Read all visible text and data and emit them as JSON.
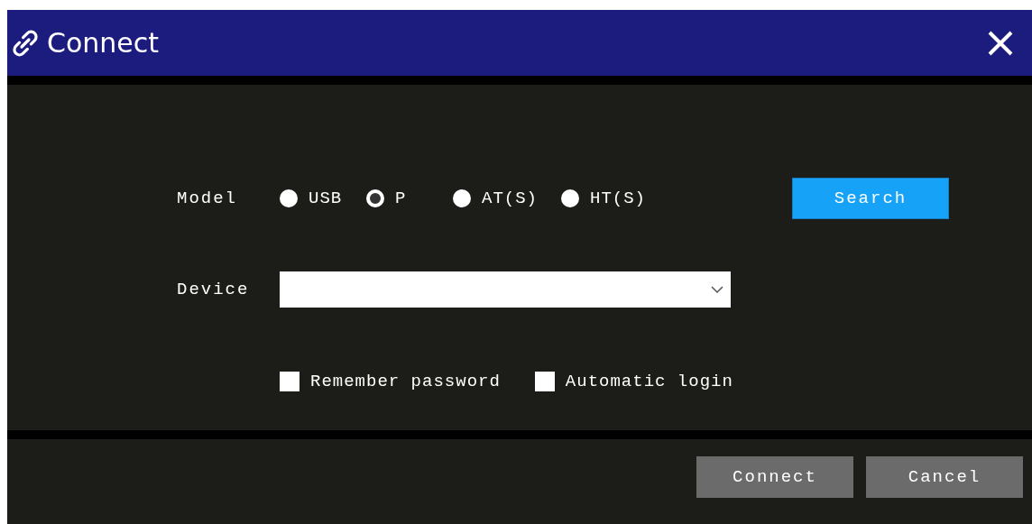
{
  "window": {
    "title": "Connect"
  },
  "model": {
    "label": "Model",
    "options": [
      {
        "label": "USB",
        "selected": false
      },
      {
        "label": "P",
        "selected": true
      },
      {
        "label": "AT(S)",
        "selected": false
      },
      {
        "label": "HT(S)",
        "selected": false
      }
    ],
    "search_button": "Search"
  },
  "device": {
    "label": "Device"
  },
  "options": [
    {
      "label": "Remember password",
      "checked": false
    },
    {
      "label": "Automatic login",
      "checked": false
    }
  ],
  "buttons": [
    "Connect",
    "Cancel"
  ]
}
